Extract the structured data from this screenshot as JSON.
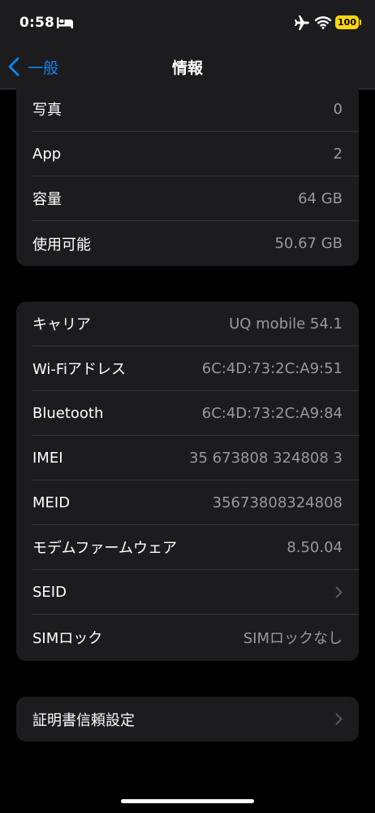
{
  "status_bar": {
    "time": "0:58",
    "battery": "100",
    "icons": [
      "bed-icon",
      "airplane-icon",
      "wifi-icon",
      "battery-icon"
    ],
    "battery_color": "#ffd60a"
  },
  "nav": {
    "back_label": "一般",
    "title": "情報",
    "accent_color": "#0a84ff"
  },
  "group1": {
    "rows": [
      {
        "label": "写真",
        "value": "0"
      },
      {
        "label": "App",
        "value": "2"
      },
      {
        "label": "容量",
        "value": "64 GB"
      },
      {
        "label": "使用可能",
        "value": "50.67 GB"
      }
    ]
  },
  "group2": {
    "rows": [
      {
        "label": "キャリア",
        "value": "UQ mobile 54.1"
      },
      {
        "label": "Wi-Fiアドレス",
        "value": "6C:4D:73:2C:A9:51"
      },
      {
        "label": "Bluetooth",
        "value": "6C:4D:73:2C:A9:84"
      },
      {
        "label": "IMEI",
        "value": "35 673808 324808 3"
      },
      {
        "label": "MEID",
        "value": "35673808324808"
      },
      {
        "label": "モデムファームウェア",
        "value": "8.50.04"
      },
      {
        "label": "SEID",
        "icon": "chevron-right-icon"
      },
      {
        "label": "SIMロック",
        "value": "SIMロックなし"
      }
    ]
  },
  "group3": {
    "rows": [
      {
        "label": "証明書信頼設定",
        "icon": "chevron-right-icon"
      }
    ]
  }
}
